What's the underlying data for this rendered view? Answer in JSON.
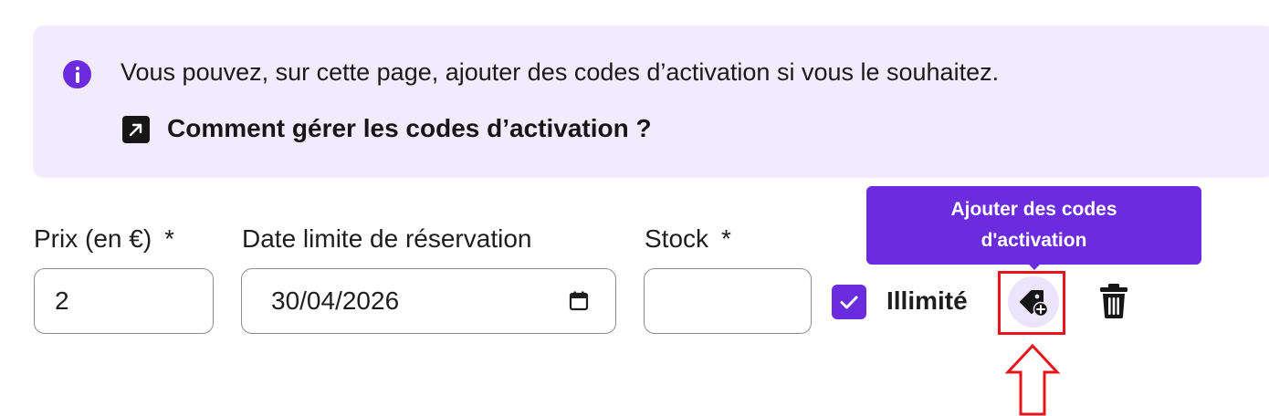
{
  "callout": {
    "icon": "info-icon",
    "text": "Vous pouvez, sur cette page, ajouter des codes d’activation si vous le souhaitez.",
    "link_icon": "external-link-icon",
    "link_label": "Comment gérer les codes d’activation ?",
    "background": "#f2ebfd",
    "accent": "#6b2ce0"
  },
  "form": {
    "price": {
      "label": "Prix (en €)",
      "required_mark": "*",
      "value": "2"
    },
    "deadline": {
      "label": "Date limite de réservation",
      "value": "30/04/2026",
      "icon": "calendar-icon"
    },
    "stock": {
      "label": "Stock",
      "required_mark": "*",
      "value": ""
    },
    "unlimited": {
      "label": "Illimité",
      "checked": true
    },
    "add_codes_button": {
      "icon": "tag-plus-icon"
    },
    "delete_button": {
      "icon": "trash-icon"
    }
  },
  "tooltip": {
    "line1": "Ajouter des codes",
    "line2": "d'activation"
  },
  "annotation": {
    "highlight_color": "#e8141a",
    "pointer": "up-arrow"
  }
}
